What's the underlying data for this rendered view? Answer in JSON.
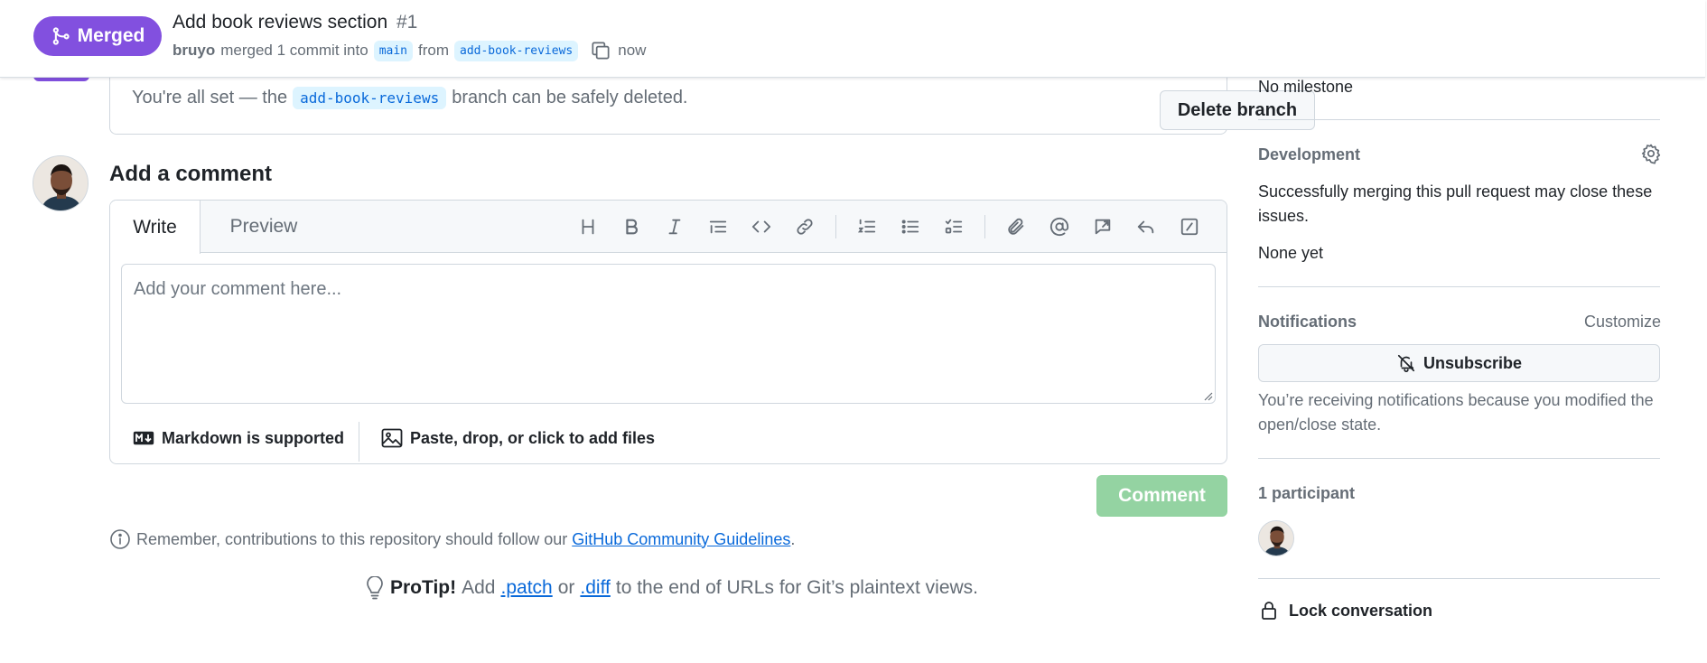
{
  "header": {
    "status_badge": "Merged",
    "title": "Add book reviews section",
    "number": "#1",
    "author": "bruyo",
    "merged_text": "merged 1 commit into",
    "base_branch": "main",
    "from_text": "from",
    "head_branch": "add-book-reviews",
    "time": "now"
  },
  "deletion_card": {
    "text_before": "You're all set — the",
    "branch": "add-book-reviews",
    "text_after": "branch can be safely deleted.",
    "delete_button": "Delete branch"
  },
  "comment": {
    "heading": "Add a comment",
    "tabs": [
      "Write",
      "Preview"
    ],
    "placeholder": "Add your comment here...",
    "markdown_label": "Markdown is supported",
    "attach_label": "Paste, drop, or click to add files",
    "submit_label": "Comment",
    "toolbar_icons": [
      "heading-icon",
      "bold-icon",
      "italic-icon",
      "quote-icon",
      "code-icon",
      "link-icon",
      "ordered-list-icon",
      "unordered-list-icon",
      "task-list-icon",
      "attach-icon",
      "mention-icon",
      "cross-reference-icon",
      "saved-reply-icon",
      "slash-command-icon"
    ]
  },
  "guidelines": {
    "text": "Remember, contributions to this repository should follow our",
    "link": "GitHub Community Guidelines",
    "period": "."
  },
  "protip": {
    "label": "ProTip!",
    "text1": "Add",
    "patch": ".patch",
    "or": "or",
    "diff": ".diff",
    "text2": "to the end of URLs for Git’s plaintext views."
  },
  "sidebar": {
    "milestone": "No milestone",
    "development_heading": "Development",
    "development_text": "Successfully merging this pull request may close these issues.",
    "development_value": "None yet",
    "notifications_heading": "Notifications",
    "customize": "Customize",
    "unsubscribe": "Unsubscribe",
    "notification_reason": "You’re receiving notifications because you modified the open/close state.",
    "participants_heading": "1 participant",
    "lock": "Lock conversation"
  },
  "colors": {
    "merged_purple": "#8250df",
    "link_blue": "#0969da",
    "comment_button_disabled": "#94d3a2"
  }
}
